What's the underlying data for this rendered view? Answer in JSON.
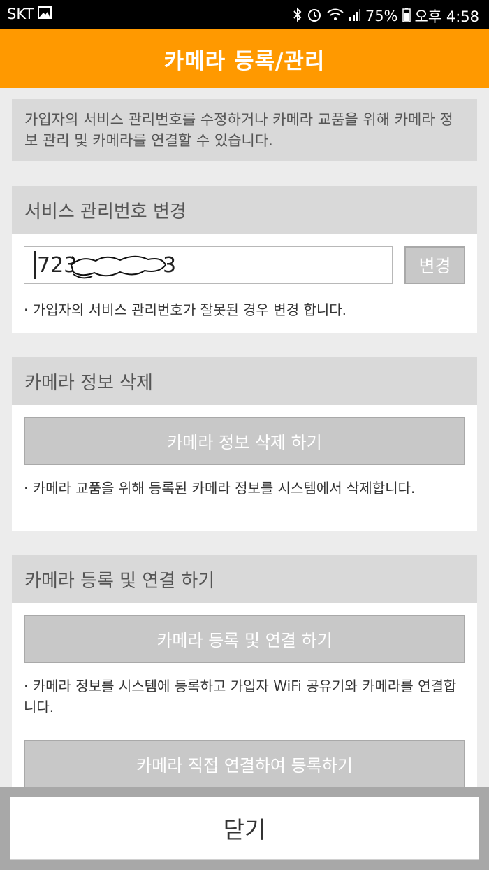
{
  "status_bar": {
    "carrier": "SKT",
    "battery": "75%",
    "time": "오후 4:58",
    "icons": [
      "gallery-icon",
      "bluetooth-icon",
      "alarm-icon",
      "wifi-icon",
      "signal-icon",
      "battery-icon"
    ]
  },
  "header": {
    "title": "카메라 등록/관리"
  },
  "intro": {
    "text": "가입자의 서비스 관리번호를 수정하거나 카메라 교품을 위해 카메라 정보 관리 및 카메라를 연결할 수 있습니다."
  },
  "service_number": {
    "title": "서비스 관리번호 변경",
    "input_value": "723",
    "input_value_suffix": "3",
    "change_label": "변경",
    "note": "· 가입자의 서비스 관리번호가 잘못된 경우 변경 합니다."
  },
  "delete_camera": {
    "title": "카메라 정보 삭제",
    "button_label": "카메라 정보 삭제 하기",
    "note": "· 카메라 교품을 위해 등록된 카메라 정보를 시스템에서 삭제합니다."
  },
  "register_camera": {
    "title": "카메라 등록 및 연결 하기",
    "button_label": "카메라 등록 및 연결 하기",
    "note": "· 카메라 정보를 시스템에 등록하고 가입자 WiFi 공유기와 카메라를 연결합니다.",
    "direct_button_label": "카메라 직접 연결하여 등록하기"
  },
  "footer": {
    "close_label": "닫기"
  },
  "colors": {
    "accent": "#ff9900",
    "section_header_bg": "#d9d9d9",
    "button_bg": "#c8c8c8",
    "page_bg": "#ececec"
  }
}
